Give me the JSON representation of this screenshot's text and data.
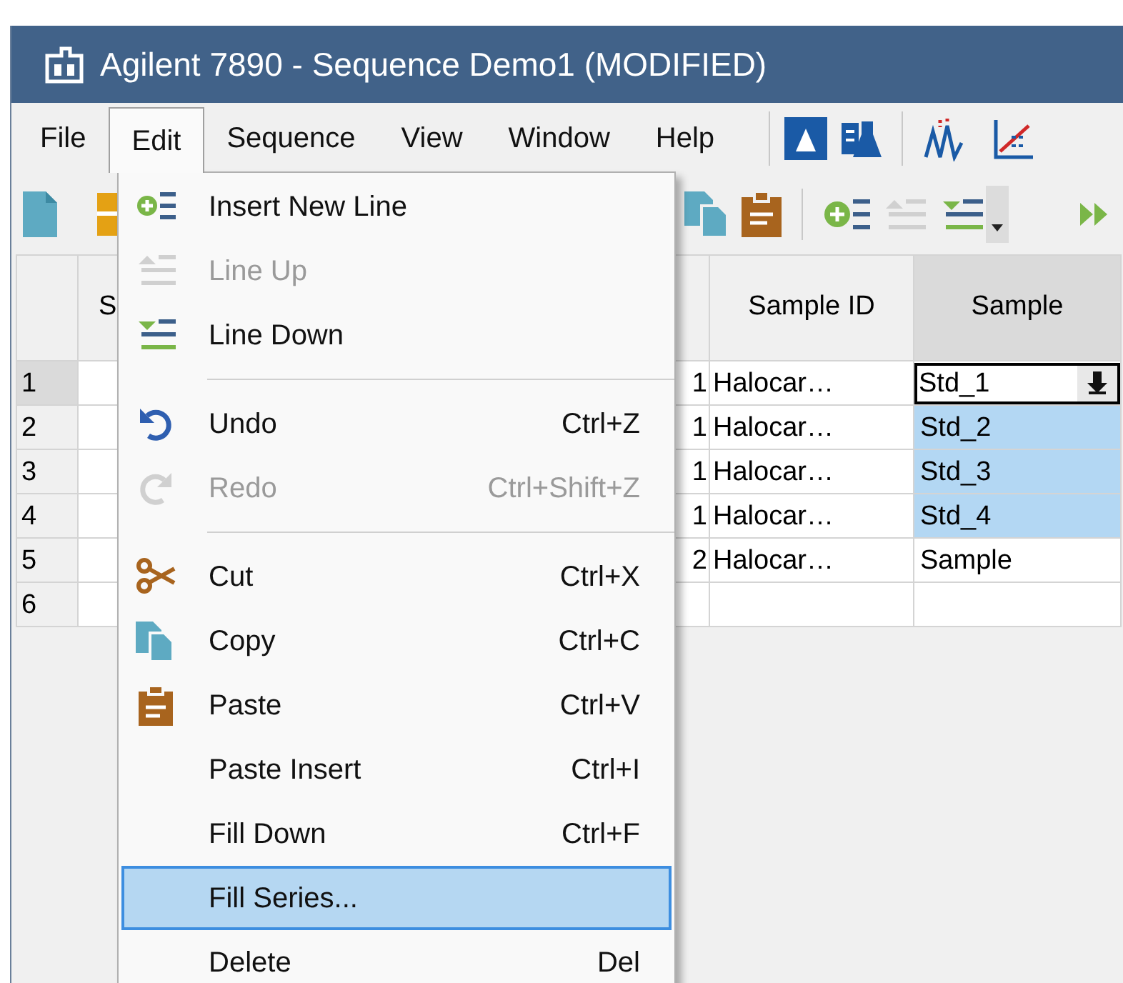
{
  "window": {
    "title": "Agilent 7890 - Sequence Demo1 (MODIFIED)"
  },
  "menu_bar": [
    {
      "label": "File",
      "selected": false
    },
    {
      "label": "Edit",
      "selected": true
    },
    {
      "label": "Sequence",
      "selected": false
    },
    {
      "label": "View",
      "selected": false
    },
    {
      "label": "Window",
      "selected": false
    },
    {
      "label": "Help",
      "selected": false
    }
  ],
  "table": {
    "columns": [
      "S",
      "",
      "Sample ID",
      "Sample"
    ],
    "rows": [
      {
        "number": "1",
        "column_2": "1",
        "sample_id": "Halocar…",
        "sample": "Std_1",
        "current": true,
        "selected": false
      },
      {
        "number": "2",
        "column_2": "1",
        "sample_id": "Halocar…",
        "sample": "Std_2",
        "current": false,
        "selected": true
      },
      {
        "number": "3",
        "column_2": "1",
        "sample_id": "Halocar…",
        "sample": "Std_3",
        "current": false,
        "selected": true
      },
      {
        "number": "4",
        "column_2": "1",
        "sample_id": "Halocar…",
        "sample": "Std_4",
        "current": false,
        "selected": true
      },
      {
        "number": "5",
        "column_2": "2",
        "sample_id": "Halocar…",
        "sample": "Sample",
        "current": false,
        "selected": false
      },
      {
        "number": "6",
        "current": false,
        "selected": false
      }
    ]
  },
  "edit_menu": [
    {
      "kind": "item",
      "label": "Insert New Line",
      "disabled": false,
      "selected": false
    },
    {
      "kind": "item",
      "label": "Line Up",
      "disabled": true,
      "selected": false
    },
    {
      "kind": "item",
      "label": "Line Down",
      "disabled": false,
      "selected": false
    },
    {
      "kind": "separator"
    },
    {
      "kind": "item",
      "label": "Undo",
      "shortcut": "Ctrl+Z",
      "disabled": false,
      "selected": false
    },
    {
      "kind": "item",
      "label": "Redo",
      "shortcut": "Ctrl+Shift+Z",
      "disabled": true,
      "selected": false
    },
    {
      "kind": "separator"
    },
    {
      "kind": "item",
      "label": "Cut",
      "shortcut": "Ctrl+X",
      "disabled": false,
      "selected": false
    },
    {
      "kind": "item",
      "label": "Copy",
      "shortcut": "Ctrl+C",
      "disabled": false,
      "selected": false
    },
    {
      "kind": "item",
      "label": "Paste",
      "shortcut": "Ctrl+V",
      "disabled": false,
      "selected": false
    },
    {
      "kind": "item",
      "label": "Paste Insert",
      "shortcut": "Ctrl+I",
      "disabled": false,
      "selected": false
    },
    {
      "kind": "item",
      "label": "Fill Down",
      "shortcut": "Ctrl+F",
      "disabled": false,
      "selected": false
    },
    {
      "kind": "item",
      "label": "Fill Series...",
      "disabled": false,
      "selected": true
    },
    {
      "kind": "item",
      "label": "Delete",
      "shortcut": "Del",
      "disabled": false,
      "selected": false
    }
  ]
}
